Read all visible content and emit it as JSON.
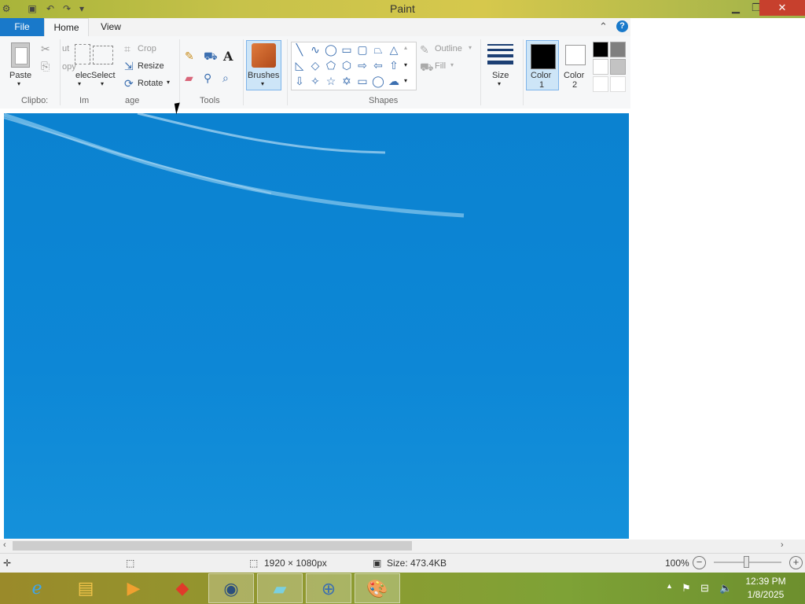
{
  "window": {
    "title": "Paint"
  },
  "qat": {
    "save_icon": "save-icon",
    "undo_icon": "undo-icon",
    "redo_icon": "redo-icon"
  },
  "ribbon": {
    "tabs": {
      "file": "File",
      "home": "Home",
      "view": "View"
    },
    "clipboard": {
      "paste": "Paste",
      "cut": "ut",
      "copy": "opy",
      "group": "Clipbo:"
    },
    "image": {
      "select_a": "elec",
      "select_b": "Select",
      "group_a": "Im",
      "group_b": "age",
      "crop": "Crop",
      "resize": "Resize",
      "rotate": "Rotate"
    },
    "tools": {
      "group": "Tools"
    },
    "brushes": {
      "label": "Brushes"
    },
    "shapes": {
      "group": "Shapes",
      "outline": "Outline",
      "fill": "Fill"
    },
    "size": {
      "label": "Size"
    },
    "colors": {
      "color1_a": "Color",
      "color1_b": "1",
      "color2_a": "Color",
      "color2_b": "2",
      "color1_value": "#000000",
      "color2_value": "#ffffff"
    }
  },
  "status": {
    "dimensions": "1920 × 1080px",
    "size": "Size: 473.4KB",
    "zoom": "100%"
  },
  "clock": {
    "time": "12:39 PM",
    "date": "1/8/2025"
  },
  "colors": {
    "file_tab": "#1979ca",
    "canvas": "#0d87d6",
    "close_button": "#c7402d"
  }
}
